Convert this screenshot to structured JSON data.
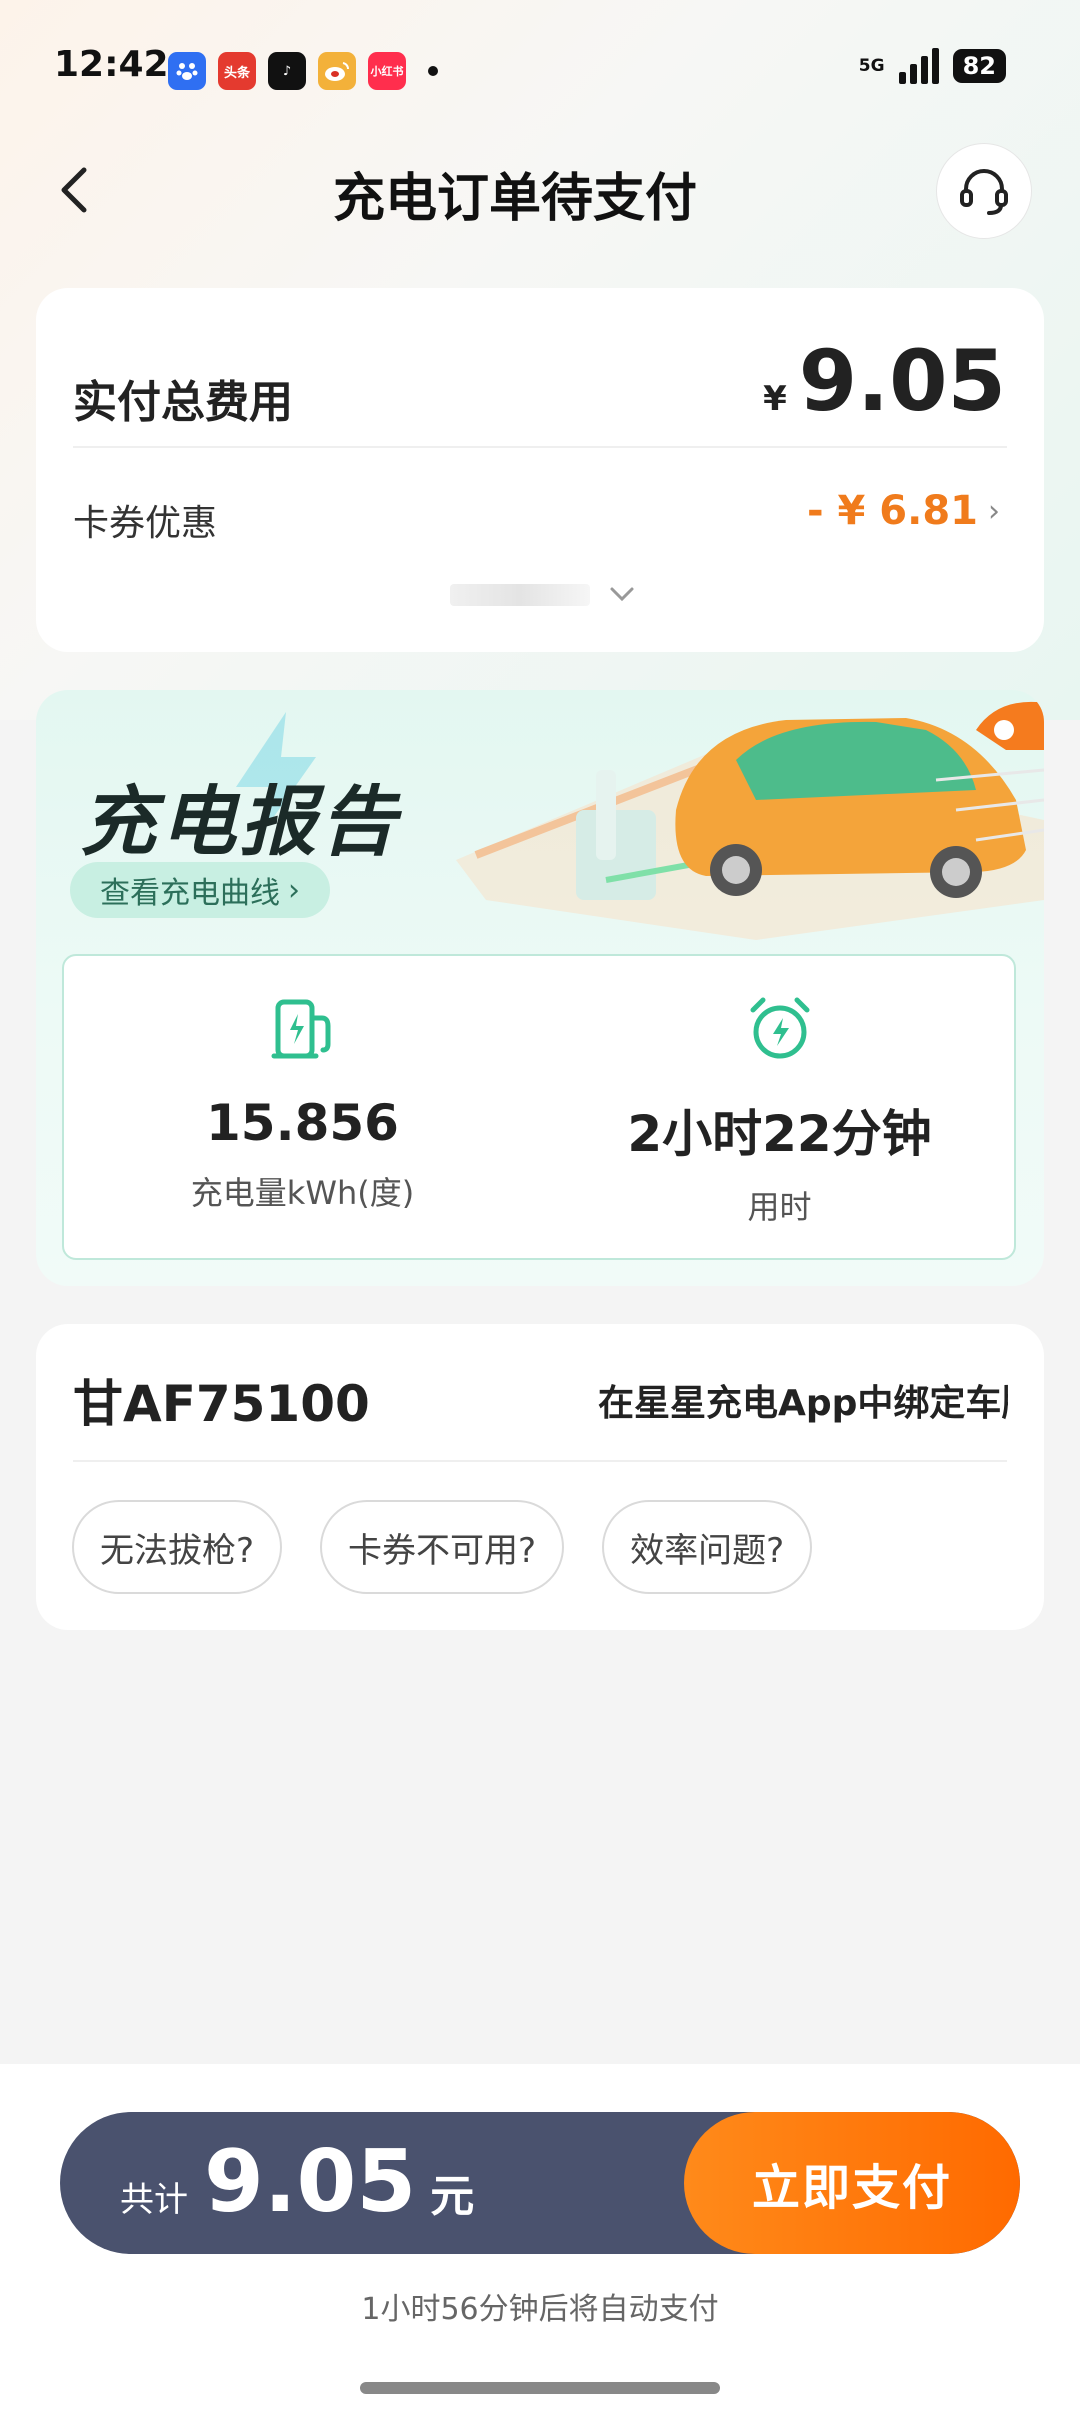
{
  "status_bar": {
    "time": "12:42",
    "apps": [
      {
        "name": "baidu-app-icon",
        "color": "#2f6ff2",
        "label": ""
      },
      {
        "name": "toutiao-app-icon",
        "color": "#e43a2f",
        "label": "头条"
      },
      {
        "name": "tiktok-app-icon",
        "color": "#111111",
        "label": "♪"
      },
      {
        "name": "weibo-app-icon",
        "color": "#f3b13a",
        "label": ""
      },
      {
        "name": "xiaohongshu-app-icon",
        "color": "#ff2e4d",
        "label": "小红书"
      }
    ],
    "network": "5G",
    "battery": "82"
  },
  "header": {
    "title": "充电订单待支付"
  },
  "summary": {
    "total_label": "实付总费用",
    "currency": "¥",
    "total_amount": "9.05",
    "coupon_label": "卡券优惠",
    "coupon_value": "- ¥ 6.81"
  },
  "report": {
    "title": "充电报告",
    "curve_link": "查看充电曲线",
    "energy_value": "15.856",
    "energy_label": "充电量kWh(度)",
    "duration_value": "2小时22分钟",
    "duration_label": "用时"
  },
  "vehicle": {
    "plate": "甘AF75100",
    "bind_text": "在星星充电App中绑定车牌"
  },
  "help_chips": [
    "无法拔枪?",
    "卡券不可用?",
    "效率问题?"
  ],
  "pay": {
    "prefix": "共计",
    "amount": "9.05",
    "unit": "元",
    "button": "立即支付",
    "auto_pay_note": "1小时56分钟后将自动支付"
  },
  "colors": {
    "accent_orange": "#ff7a10",
    "green": "#2fbf8f",
    "pay_bar": "#4a526e"
  }
}
